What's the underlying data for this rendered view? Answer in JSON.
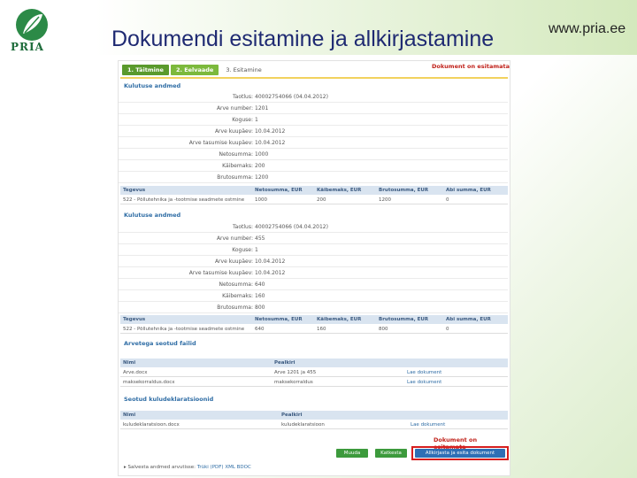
{
  "slide": {
    "title": "Dokumendi esitamine ja allkirjastamine",
    "website": "www.pria.ee",
    "logo_text": "PRIA"
  },
  "steps": [
    {
      "label": "1. Täitmine"
    },
    {
      "label": "2. Eelvaade"
    },
    {
      "label": "3. Esitamine"
    }
  ],
  "doc_status_top": "Dokument on esitamata",
  "doc_status_bottom": "Dokument on esitamata",
  "invoices": [
    {
      "section_title": "Kulutuse andmed",
      "fields": [
        {
          "key": "Taotlus:",
          "value": "40002754066 (04.04.2012)"
        },
        {
          "key": "Arve number:",
          "value": "1201"
        },
        {
          "key": "Koguse:",
          "value": "1"
        },
        {
          "key": "Arve kuupäev:",
          "value": "10.04.2012"
        },
        {
          "key": "Arve tasumise kuupäev:",
          "value": "10.04.2012"
        },
        {
          "key": "Netosumma:",
          "value": "1000"
        },
        {
          "key": "Käibemaks:",
          "value": "200"
        },
        {
          "key": "Brutosumma:",
          "value": "1200"
        }
      ],
      "table_headers": [
        "Tegevus",
        "Netosumma, EUR",
        "Käibemaks, EUR",
        "Brutosumma, EUR",
        "Abi summa, EUR"
      ],
      "row": [
        "522 - Põllutehnika ja -tootmise seadmete ostmine",
        "1000",
        "200",
        "1200",
        "0"
      ]
    },
    {
      "section_title": "Kulutuse andmed",
      "fields": [
        {
          "key": "Taotlus:",
          "value": "40002754066 (04.04.2012)"
        },
        {
          "key": "Arve number:",
          "value": "455"
        },
        {
          "key": "Koguse:",
          "value": "1"
        },
        {
          "key": "Arve kuupäev:",
          "value": "10.04.2012"
        },
        {
          "key": "Arve tasumise kuupäev:",
          "value": "10.04.2012"
        },
        {
          "key": "Netosumma:",
          "value": "640"
        },
        {
          "key": "Käibemaks:",
          "value": "160"
        },
        {
          "key": "Brutosumma:",
          "value": "800"
        }
      ],
      "table_headers": [
        "Tegevus",
        "Netosumma, EUR",
        "Käibemaks, EUR",
        "Brutosumma, EUR",
        "Abi summa, EUR"
      ],
      "row": [
        "522 - Põllutehnika ja -tootmise seadmete ostmine",
        "640",
        "160",
        "800",
        "0"
      ]
    }
  ],
  "attached_files": {
    "section_title": "Arvetega seotud failid",
    "headers": [
      "Nimi",
      "Pealkiri"
    ],
    "rows": [
      {
        "name": "Arve.docx",
        "title": "Arve 1201 ja 455",
        "action": "Lae dokument"
      },
      {
        "name": "maksekorraldus.docx",
        "title": "maksekorraldus",
        "action": "Lae dokument"
      }
    ]
  },
  "declarations": {
    "section_title": "Seotud kuludeklaratsioonid",
    "headers": [
      "Nimi",
      "Pealkiri"
    ],
    "rows": [
      {
        "name": "kuludeklaratsioon.docx",
        "title": "kuludeklaratsioon",
        "action": "Lae dokument"
      }
    ]
  },
  "buttons": {
    "back": "Muuda",
    "cancel": "Katkesta",
    "sign": "Allkirjasta ja esita dokument"
  },
  "footer": {
    "label": "Salvesta andmed arvutisse:",
    "link_pdf": "Trüki (PDF)",
    "link_xml": "XML",
    "link_bdoc": "BDOC"
  },
  "colors": {
    "title": "#1f2a72",
    "step_active": "#7cb93c",
    "step_done": "#5a9a2c",
    "status_red": "#c0221b",
    "section_blue": "#2f6da5",
    "table_header_bg": "#d9e4f0",
    "highlight_border": "#d61e1e"
  }
}
